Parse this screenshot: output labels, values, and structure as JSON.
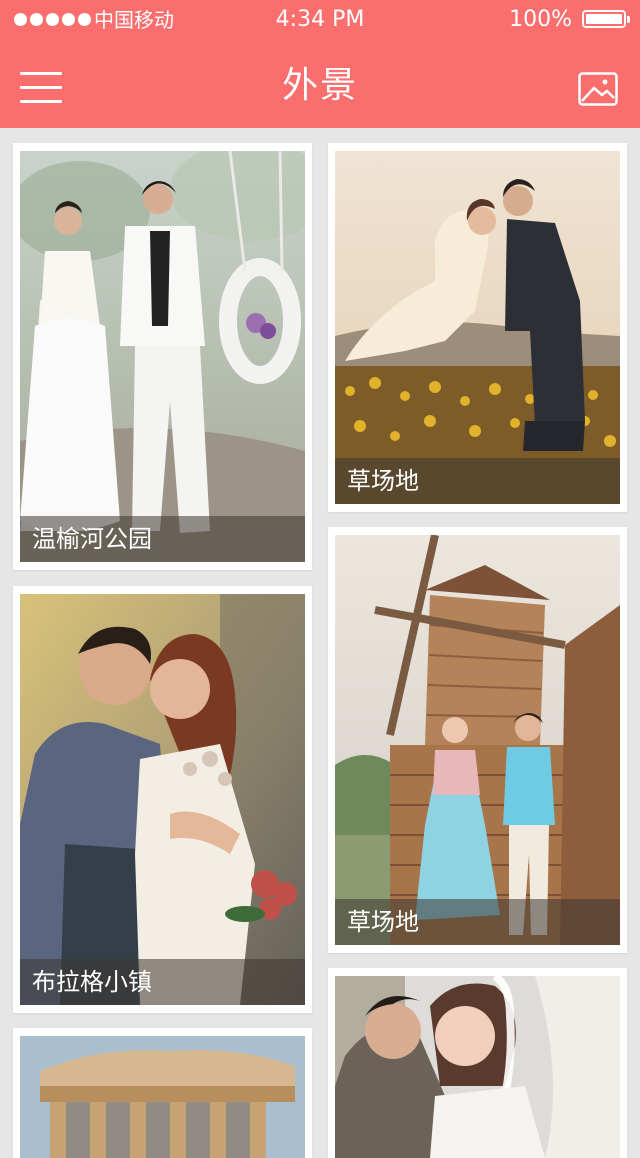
{
  "status_bar": {
    "carrier": "中国移动",
    "time": "4:34 PM",
    "battery": "100%"
  },
  "navbar": {
    "title": "外景",
    "menu_icon": "hamburger-menu-icon",
    "right_icon": "photo-gallery-icon"
  },
  "colors": {
    "accent": "#fa6e6e",
    "background": "#e6e6e6"
  },
  "cards": [
    {
      "caption": "温榆河公园"
    },
    {
      "caption": "草场地"
    },
    {
      "caption": "布拉格小镇"
    },
    {
      "caption": "草场地"
    },
    {
      "caption": ""
    },
    {
      "caption": ""
    }
  ]
}
